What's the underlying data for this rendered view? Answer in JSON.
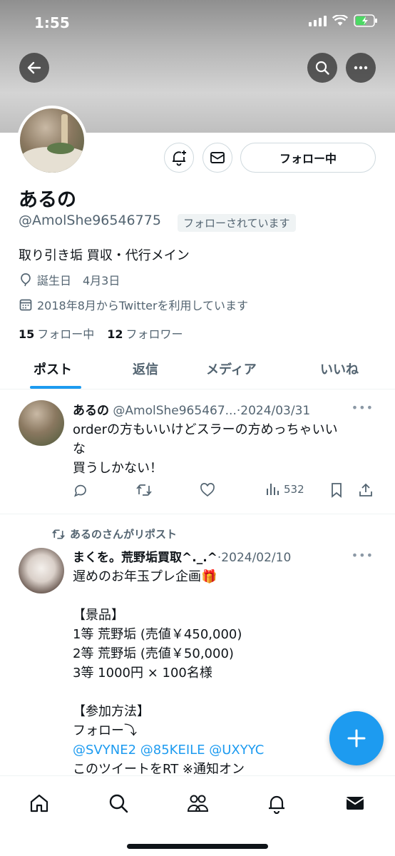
{
  "status_bar": {
    "time": "1:55"
  },
  "profile": {
    "name": "あるの",
    "handle": "@AmolShe96546775",
    "follows_you": "フォローされています",
    "bio": "取り引き垢 買収・代行メイン",
    "birthday": "誕生日　4月3日",
    "joined": "2018年8月からTwitterを利用しています",
    "following_count": "15",
    "following_label": "フォロー中",
    "followers_count": "12",
    "followers_label": "フォロワー",
    "follow_button": "フォロー中"
  },
  "tabs": [
    {
      "label": "ポスト",
      "active": true
    },
    {
      "label": "返信",
      "active": false
    },
    {
      "label": "メディア",
      "active": false
    },
    {
      "label": "いいね",
      "active": false
    }
  ],
  "posts": [
    {
      "name": "あるの",
      "handle_date": "@AmolShe965467...·2024/03/31",
      "lines": [
        "orderの方もいいけどスラーの方めっちゃいい",
        "な",
        "買うしかない！"
      ],
      "views": "532"
    },
    {
      "repost_label": "あるのさんがリポスト",
      "name": "まくを。荒野垢買取^._.^",
      "handle_date": "·2024/02/10",
      "lines": [
        "遅めのお年玉プレ企画🎁",
        "",
        "【景品】",
        "1等 荒野垢 (売値￥450,000)",
        "2等 荒野垢 (売値￥50,000)",
        "3等 1000円 × 100名様",
        "",
        "【参加方法】",
        "フォロー⤵",
        "@SVYNE2 @85KEILE @UXYYC",
        "このツイートをRT ※通知オン"
      ]
    }
  ],
  "colors": {
    "accent": "#1d9bf0",
    "secondary_text": "#536471",
    "text": "#0f1419"
  }
}
